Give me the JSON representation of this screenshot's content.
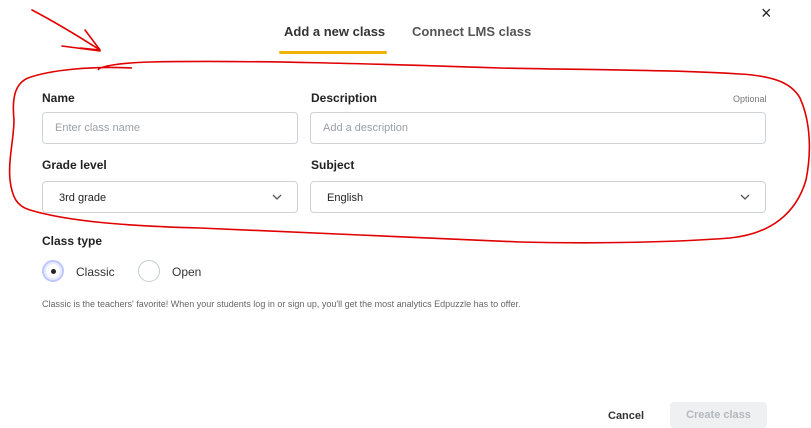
{
  "tabs": [
    {
      "label": "Add a new class",
      "active": true
    },
    {
      "label": "Connect LMS class",
      "active": false
    }
  ],
  "close_symbol": "×",
  "form": {
    "name": {
      "label": "Name",
      "placeholder": "Enter class name",
      "value": ""
    },
    "description": {
      "label": "Description",
      "optional": "Optional",
      "placeholder": "Add a description",
      "value": ""
    },
    "grade_level": {
      "label": "Grade level",
      "selected": "3rd grade"
    },
    "subject": {
      "label": "Subject",
      "selected": "English"
    }
  },
  "class_type": {
    "label": "Class type",
    "options": [
      {
        "label": "Classic",
        "checked": true
      },
      {
        "label": "Open",
        "checked": false
      }
    ],
    "hint": "Classic is the teachers' favorite! When your students log in or sign up, you'll get the most analytics Edpuzzle has to offer."
  },
  "footer": {
    "cancel_label": "Cancel",
    "create_label": "Create class",
    "create_disabled": true
  },
  "colors": {
    "tab_accent": "#f0b400",
    "annotation": "#e00000",
    "disabled_bg": "#eef0f2"
  },
  "icons": [
    "close-icon",
    "chevron-down-icon",
    "radio-checked-icon",
    "radio-unchecked-icon"
  ]
}
